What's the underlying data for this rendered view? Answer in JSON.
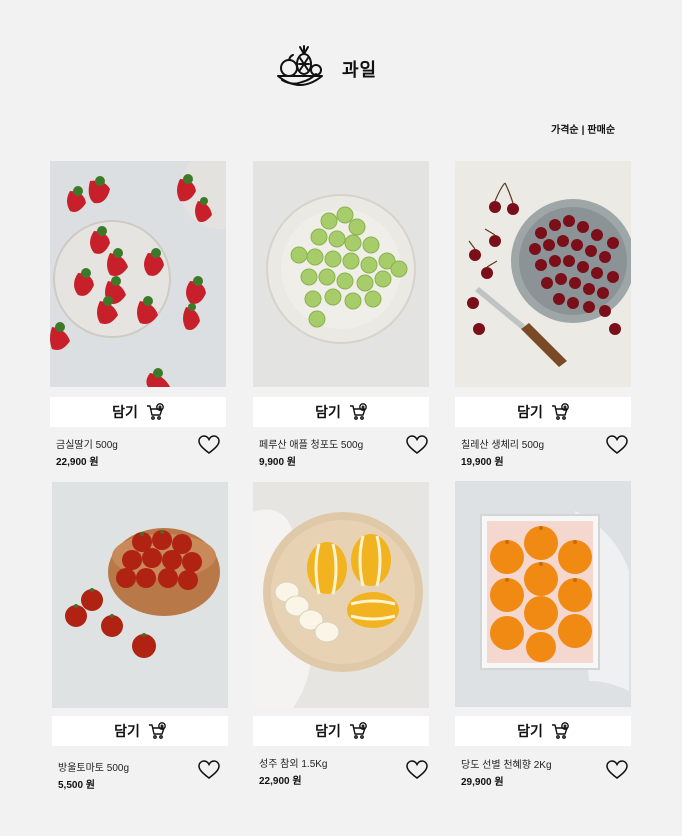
{
  "page": {
    "title": "과일",
    "sort": {
      "by_price": "가격순",
      "separator": "|",
      "by_sales": "판매순"
    }
  },
  "products": [
    {
      "name": "금실딸기 500g",
      "price": "22,900 원",
      "cart_label": "담기",
      "image": "strawberries"
    },
    {
      "name": "페루산 애플 청포도 500g",
      "price": "9,900 원",
      "cart_label": "담기",
      "image": "green-grapes"
    },
    {
      "name": "칠레산 생체리 500g",
      "price": "19,900 원",
      "cart_label": "담기",
      "image": "cherries"
    },
    {
      "name": "방울토마토 500g",
      "price": "5,500 원",
      "cart_label": "담기",
      "image": "cherry-tomatoes"
    },
    {
      "name": "성주 참외 1.5Kg",
      "price": "22,900 원",
      "cart_label": "담기",
      "image": "korean-melons"
    },
    {
      "name": "당도 선별 천혜향 2Kg",
      "price": "29,900 원",
      "cart_label": "담기",
      "image": "hallabong-oranges"
    }
  ],
  "colors": {
    "background": "#f2f2f2",
    "button": "#ffffff",
    "text": "#111111"
  }
}
